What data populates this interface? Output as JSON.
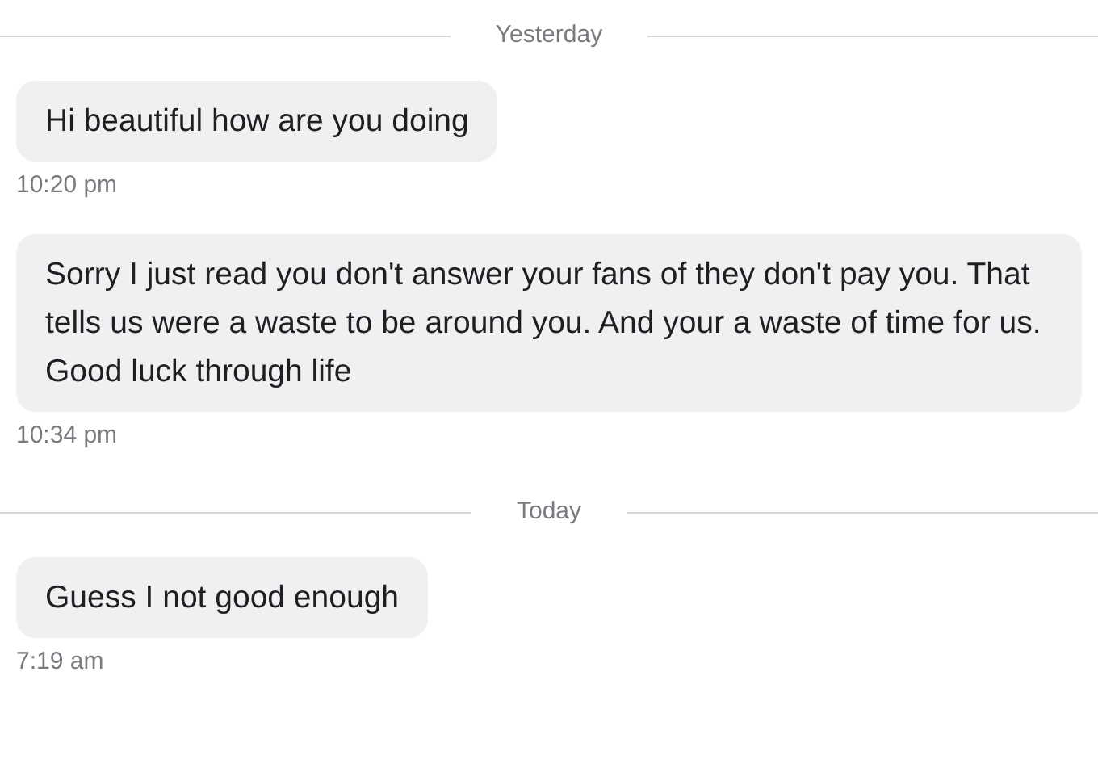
{
  "thread": [
    {
      "kind": "divider",
      "label": "Yesterday"
    },
    {
      "kind": "message",
      "text": "Hi beautiful how are you doing",
      "time": "10:20 pm"
    },
    {
      "kind": "message",
      "text": "Sorry I just read you don't answer your fans of they don't pay you. That tells us were a waste to be around you. And your a waste of time for us. Good luck through life",
      "time": "10:34 pm"
    },
    {
      "kind": "divider",
      "label": "Today"
    },
    {
      "kind": "message",
      "text": "Guess I not good enough",
      "time": "7:19 am"
    }
  ]
}
